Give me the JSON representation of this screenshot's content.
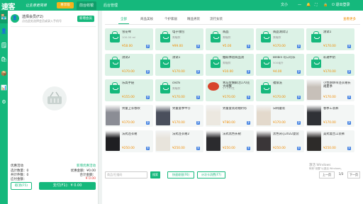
{
  "topbar": {
    "logo": "速客",
    "slogan": "让生意更简单",
    "vip_label": "尊享版",
    "tabs": [
      "前台收银",
      "后台管理"
    ],
    "active_tab": 0,
    "right_user": "文小",
    "right_exit": "退出登录"
  },
  "rail": {
    "items": [
      "收银",
      "会员",
      "订单",
      "商品",
      "库存",
      "报表",
      "设置"
    ]
  },
  "panel": {
    "member_title": "选择会员(F2)",
    "member_sub": "点击此处选择会员或录入手机号",
    "member_btn": "新增会员",
    "promo_left": "优惠活动",
    "promo_right": "新增优惠活动",
    "row1_l": "选计数量：0",
    "row1_r": "优惠金额：¥0.00",
    "row2_l": "共计件数：0",
    "row2_r": "合计金额：",
    "row3_l": "应付金额：",
    "row3_r": "¥ 0.00",
    "cancel": "取消(F5)",
    "pay": "支付(F1)：¥ 0.00"
  },
  "main": {
    "categories": [
      "全部",
      "商品美妆",
      "个护家居",
      "精品男装",
      "流行女装"
    ],
    "more": "查看更多",
    "products": [
      {
        "name": "雪花啤",
        "desc": "100.00 ml",
        "price": "¥58.00",
        "style": "green",
        "img": "bag"
      },
      {
        "name": "电子钱包",
        "desc": "美瞳款",
        "price": "¥99.00",
        "style": "green",
        "img": "bag"
      },
      {
        "name": "商品",
        "desc": "美瞳款",
        "price": "¥5.00",
        "style": "green",
        "img": "bag"
      },
      {
        "name": "商品测试订",
        "desc": "美瞳款",
        "price": "¥170.00",
        "style": "green",
        "img": "bag"
      },
      {
        "name": "测试1",
        "desc": "",
        "price": "¥170.00",
        "style": "green",
        "img": "bag"
      },
      {
        "name": "测试2",
        "desc": "",
        "price": "¥170.00",
        "style": "green",
        "img": "bag"
      },
      {
        "name": "测试1",
        "desc": "",
        "price": "¥170.00",
        "style": "green",
        "img": "bag"
      },
      {
        "name": "抽取体验商品测",
        "desc": "美瞳款",
        "price": "¥10.00",
        "style": "green",
        "img": "bag"
      },
      {
        "name": "Bilibili 可口可乐",
        "desc": "500毫升",
        "price": "¥4.00",
        "style": "green",
        "img": "bag"
      },
      {
        "name": "彩通牛奶",
        "desc": "",
        "price": "¥170.00",
        "style": "green",
        "img": "bag"
      },
      {
        "name": "乐高手链",
        "desc": "",
        "price": "¥155.00",
        "style": "green",
        "img": "bag"
      },
      {
        "name": "cechi",
        "desc": "美瞳款",
        "price": "¥170.00",
        "style": "green",
        "img": "bag"
      },
      {
        "name": "青岛金蟹鲜活170克大闸蟹",
        "desc": "1~170克",
        "price": "¥170.00",
        "style": "green",
        "img": "crab"
      },
      {
        "name": "福保洗",
        "desc": "",
        "price": "¥170.00",
        "style": "green",
        "img": "bag"
      },
      {
        "name": "小性感绑带连衣裙长裙夏季",
        "desc": "",
        "price": "¥170.00",
        "style": "white",
        "img": "photo",
        "color": "#c7c0b9"
      },
      {
        "name": "男童卫衣春秋",
        "desc": "",
        "price": "¥170.00",
        "style": "white",
        "img": "photo",
        "color": "#8b8d95"
      },
      {
        "name": "男童夏季牛仔",
        "desc": "",
        "price": "¥170.00",
        "style": "white",
        "img": "photo",
        "color": "#4a4f5c"
      },
      {
        "name": "男童夏装短袖衬衫",
        "desc": "",
        "price": "¥780.00",
        "style": "white",
        "img": "photo",
        "color": "#ece8e0"
      },
      {
        "name": "日韩童装",
        "desc": "",
        "price": "¥170.00",
        "style": "white",
        "img": "photo",
        "color": "#e3d9cc"
      },
      {
        "name": "春季工装裤",
        "desc": "",
        "price": "¥170.00",
        "style": "white",
        "img": "photo",
        "color": "#2f3136"
      },
      {
        "name": "法式连衣裙",
        "desc": "",
        "price": "¥250.00",
        "style": "white",
        "img": "photo",
        "color": "#1f1f22"
      },
      {
        "name": "法式连衣裙2",
        "desc": "",
        "price": "¥250.00",
        "style": "white",
        "img": "photo",
        "color": "#e8e4dc"
      },
      {
        "name": "法式黑色长裙",
        "desc": "",
        "price": "¥250.00",
        "style": "white",
        "img": "photo",
        "color": "#2b2b2e"
      },
      {
        "name": "黑色背心2022夏装",
        "desc": "",
        "price": "¥250.00",
        "style": "white",
        "img": "photo",
        "color": "#3a3638"
      },
      {
        "name": "美式复古工装裤",
        "desc": "",
        "price": "¥250.00",
        "style": "white",
        "img": "photo",
        "color": "#2d2b29"
      }
    ]
  },
  "bottombar": {
    "search_placeholder": "商品/扫描码",
    "search_btn": "搜索",
    "btn1": "快速收银(F6)",
    "btn2": "计次卡消费(F7)",
    "prev": "上一页",
    "page": "1/3",
    "next": "下一页"
  },
  "watermark": {
    "line1": "激活 Windows",
    "line2": "转到\"设置\"以激活 Windows。"
  },
  "colors": {
    "brand": "#15b87c",
    "price": "#f08c00",
    "danger": "#e53935"
  }
}
